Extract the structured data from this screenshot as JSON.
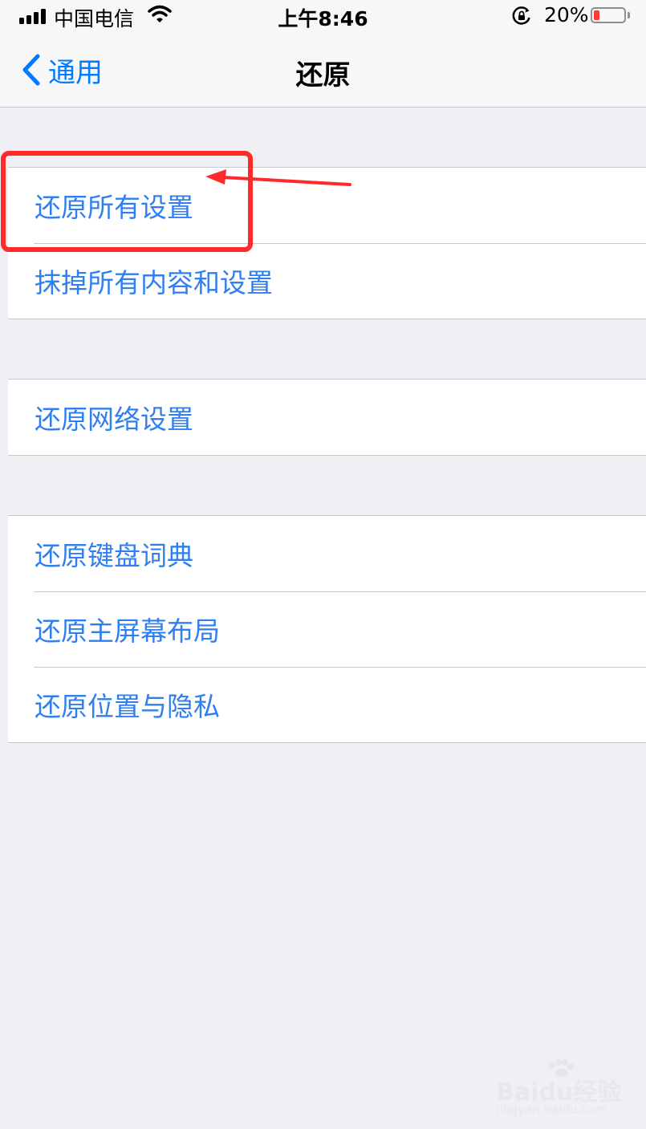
{
  "status_bar": {
    "carrier": "中国电信",
    "time": "上午8:46",
    "battery_percent": "20%",
    "battery_level": 0.2,
    "icons": [
      "signal-icon",
      "wifi-icon",
      "orientation-lock-icon",
      "battery-icon"
    ],
    "battery_color": "#ff3b30"
  },
  "nav": {
    "back_label": "通用",
    "title": "还原",
    "accent_color": "#007aff"
  },
  "groups": [
    {
      "items": [
        {
          "label": "还原所有设置"
        },
        {
          "label": "抹掉所有内容和设置"
        }
      ]
    },
    {
      "items": [
        {
          "label": "还原网络设置"
        }
      ]
    },
    {
      "items": [
        {
          "label": "还原键盘词典"
        },
        {
          "label": "还原主屏幕布局"
        },
        {
          "label": "还原位置与隐私"
        }
      ]
    }
  ],
  "annotation": {
    "target": "还原所有设置",
    "color": "#ff2b2b"
  },
  "watermark": {
    "main": "Baidu经验",
    "sub": "jingyan.baidu.com"
  }
}
